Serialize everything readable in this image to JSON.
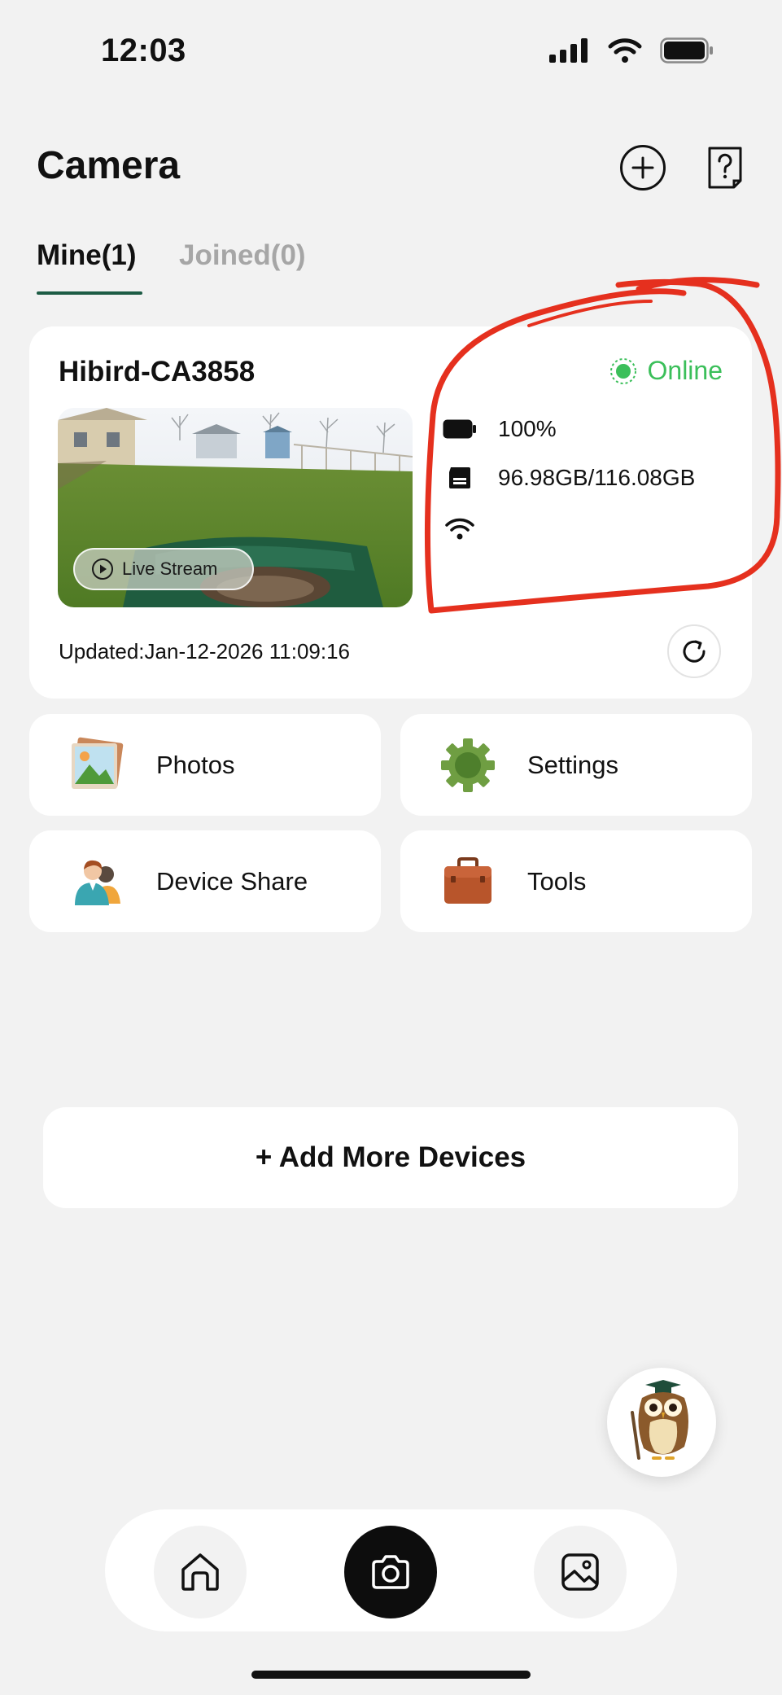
{
  "status_bar": {
    "time": "12:03"
  },
  "header": {
    "title": "Camera"
  },
  "tabs": [
    {
      "label": "Mine(1)",
      "active": true
    },
    {
      "label": "Joined(0)",
      "active": false
    }
  ],
  "device": {
    "name": "Hibird-CA3858",
    "status": "Online",
    "battery": "100%",
    "storage": "96.98GB/116.08GB",
    "live_stream_label": "Live Stream",
    "updated": "Updated:Jan-12-2026 11:09:16"
  },
  "tiles": [
    {
      "label": "Photos",
      "icon": "photos-icon"
    },
    {
      "label": "Settings",
      "icon": "gear-icon"
    },
    {
      "label": "Device Share",
      "icon": "users-icon"
    },
    {
      "label": "Tools",
      "icon": "toolbox-icon"
    }
  ],
  "add_more": {
    "label": "+ Add More Devices"
  },
  "nav": [
    {
      "name": "home",
      "icon": "home-icon"
    },
    {
      "name": "camera",
      "icon": "camera-icon",
      "active": true
    },
    {
      "name": "gallery",
      "icon": "gallery-icon"
    }
  ],
  "colors": {
    "accent": "#1d5c45",
    "online": "#3bbf5a",
    "annotation": "#e5301e",
    "background": "#f2f2f2"
  }
}
